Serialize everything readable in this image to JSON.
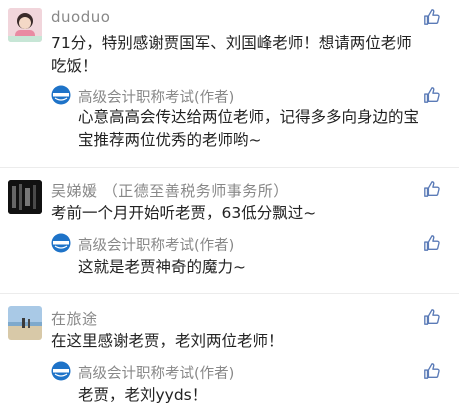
{
  "comments": [
    {
      "name": "duoduo",
      "text": "71分，特别感谢贾国军、刘国峰老师！想请两位老师吃饭！",
      "reply": {
        "name": "高级会计职称考试(作者)",
        "text": "心意高高会传达给两位老师，记得多多向身边的宝宝推荐两位优秀的老师哟~"
      }
    },
    {
      "name": "吴娣媛 （正德至善税务师事务所）",
      "text": "考前一个月开始听老贾，63低分飘过~",
      "reply": {
        "name": "高级会计职称考试(作者)",
        "text": "这就是老贾神奇的魔力~"
      }
    },
    {
      "name": "在旅途",
      "text": "在这里感谢老贾，老刘两位老师！",
      "reply": {
        "name": "高级会计职称考试(作者)",
        "text": "老贾，老刘yyds！"
      }
    }
  ],
  "icons": {
    "like": "thumbs-up-icon",
    "author_avatar": "author-logo-icon"
  },
  "colors": {
    "name_gray": "#888888",
    "text": "#222222",
    "like_blue": "#5b7bb7",
    "divider": "#ececec"
  }
}
